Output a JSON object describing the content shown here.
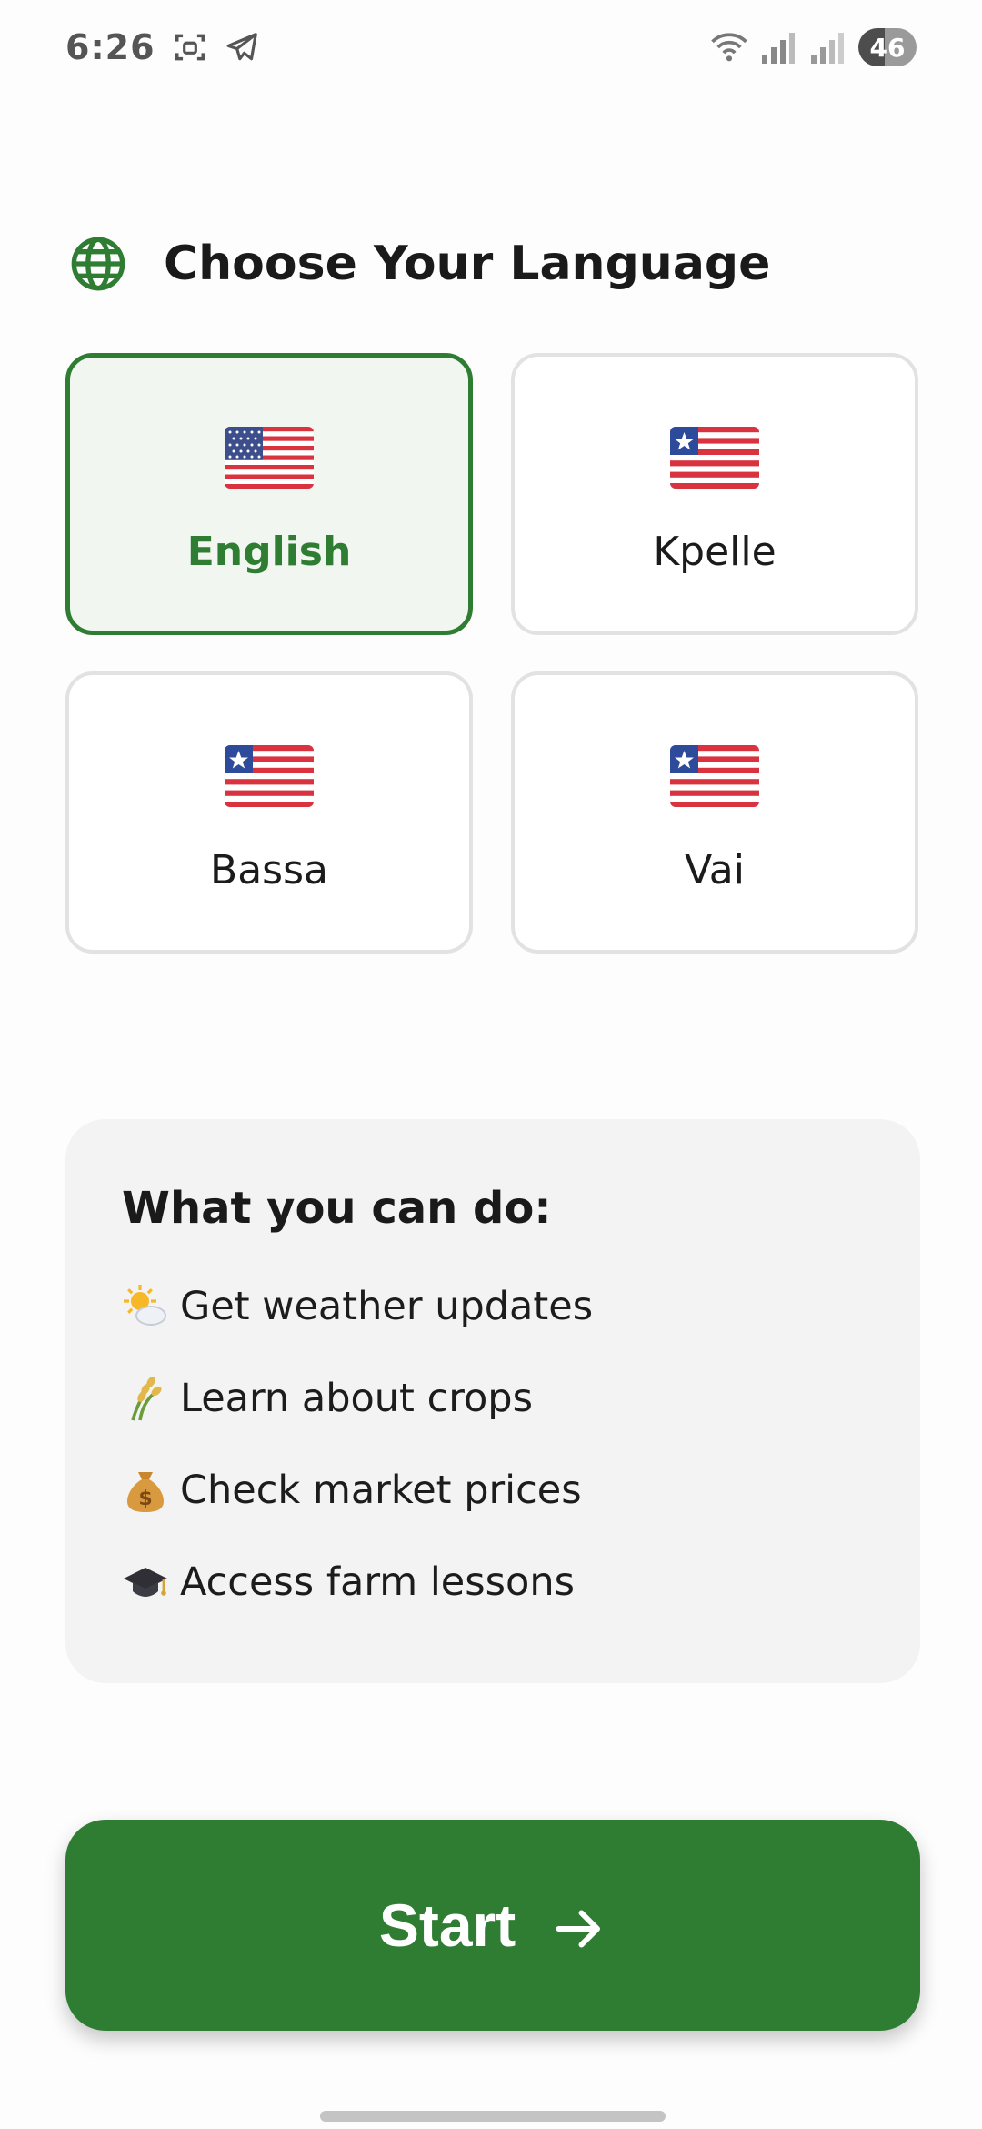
{
  "status_bar": {
    "time": "6:26",
    "battery": "46",
    "icons": [
      "screenshot-icon",
      "telegram-icon",
      "wifi-icon",
      "signal-icon",
      "signal-icon-2"
    ]
  },
  "heading": {
    "icon": "globe-icon",
    "title": "Choose Your Language"
  },
  "languages": [
    {
      "label": "English",
      "flag": "us-flag",
      "selected": true
    },
    {
      "label": "Kpelle",
      "flag": "liberia-flag",
      "selected": false
    },
    {
      "label": "Bassa",
      "flag": "liberia-flag",
      "selected": false
    },
    {
      "label": "Vai",
      "flag": "liberia-flag",
      "selected": false
    }
  ],
  "features": {
    "title": "What you can do:",
    "items": [
      {
        "icon": "sun-cloud-icon",
        "text": "Get weather updates"
      },
      {
        "icon": "rice-icon",
        "text": "Learn about crops"
      },
      {
        "icon": "money-bag-icon",
        "text": "Check market prices"
      },
      {
        "icon": "graduation-cap-icon",
        "text": "Access farm lessons"
      }
    ]
  },
  "start_button": {
    "label": "Start",
    "icon": "arrow-right-icon"
  },
  "colors": {
    "primary": "#2e7d32",
    "selected_bg": "#f1f6f1",
    "panel_bg": "#f3f3f3",
    "card_border": "#e2e2e2"
  }
}
